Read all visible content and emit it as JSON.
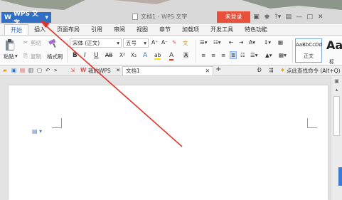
{
  "titlebar": {
    "app_name": "WPS 文字",
    "app_logo": "W",
    "dropdown": "▾",
    "doc_title": "文档1 - WPS 文字",
    "login": "未登录",
    "icons": [
      "shirt-icon",
      "skin-icon",
      "help-icon",
      "restore-icon",
      "minimize-icon",
      "maximize-icon",
      "close-icon"
    ],
    "icon_glyphs": [
      "▣",
      "♚",
      "?▾",
      "▤",
      "—",
      "□",
      "✕"
    ]
  },
  "menu": {
    "tabs": [
      "开始",
      "插入",
      "页面布局",
      "引用",
      "审阅",
      "视图",
      "章节",
      "加载项",
      "开发工具",
      "特色功能"
    ],
    "active": 0
  },
  "ribbon": {
    "paste": "粘贴",
    "cut": "剪切",
    "copy": "复制",
    "format_painter": "格式刷",
    "font_name": "宋体 (正文)",
    "font_size": "五号",
    "grow_font": "A⁺",
    "shrink_font": "A⁻",
    "clear_format": "✎",
    "phonetic": "文",
    "bold": "B",
    "italic": "I",
    "underline": "U",
    "strikethrough": "AB",
    "superscript": "X²",
    "subscript": "X₂",
    "text_effect": "A",
    "highlight": "ab",
    "font_color": "A",
    "char_shading": "A",
    "bullets": "☰▾",
    "numbering": "☷▾",
    "indent_dec": "⇤",
    "indent_inc": "⇥",
    "chinese_layout": "A▾",
    "sort": "↕▾",
    "table": "▦",
    "align_left": "≡",
    "align_center": "≡",
    "align_right": "≡",
    "justify": "≣",
    "distributed": "☷",
    "line_spacing": "☰▾",
    "shading": "▲▾",
    "border": "▦▾",
    "style_normal_sample": "AaBbCcDd",
    "style_normal_name": "正文",
    "style_big": "Aa",
    "style_big_name": "标"
  },
  "quickbar": {
    "my_wps": "我的WPS",
    "doc_tab": "文档1",
    "close": "✕",
    "new_tab": "+",
    "search": "点此查找命令 (Alt+Q)"
  },
  "document": {
    "paragraph_marker": "▤ ▾"
  },
  "colors": {
    "accent": "#2f6fc6",
    "login": "#e8503a",
    "arrow": "#e0342a"
  }
}
